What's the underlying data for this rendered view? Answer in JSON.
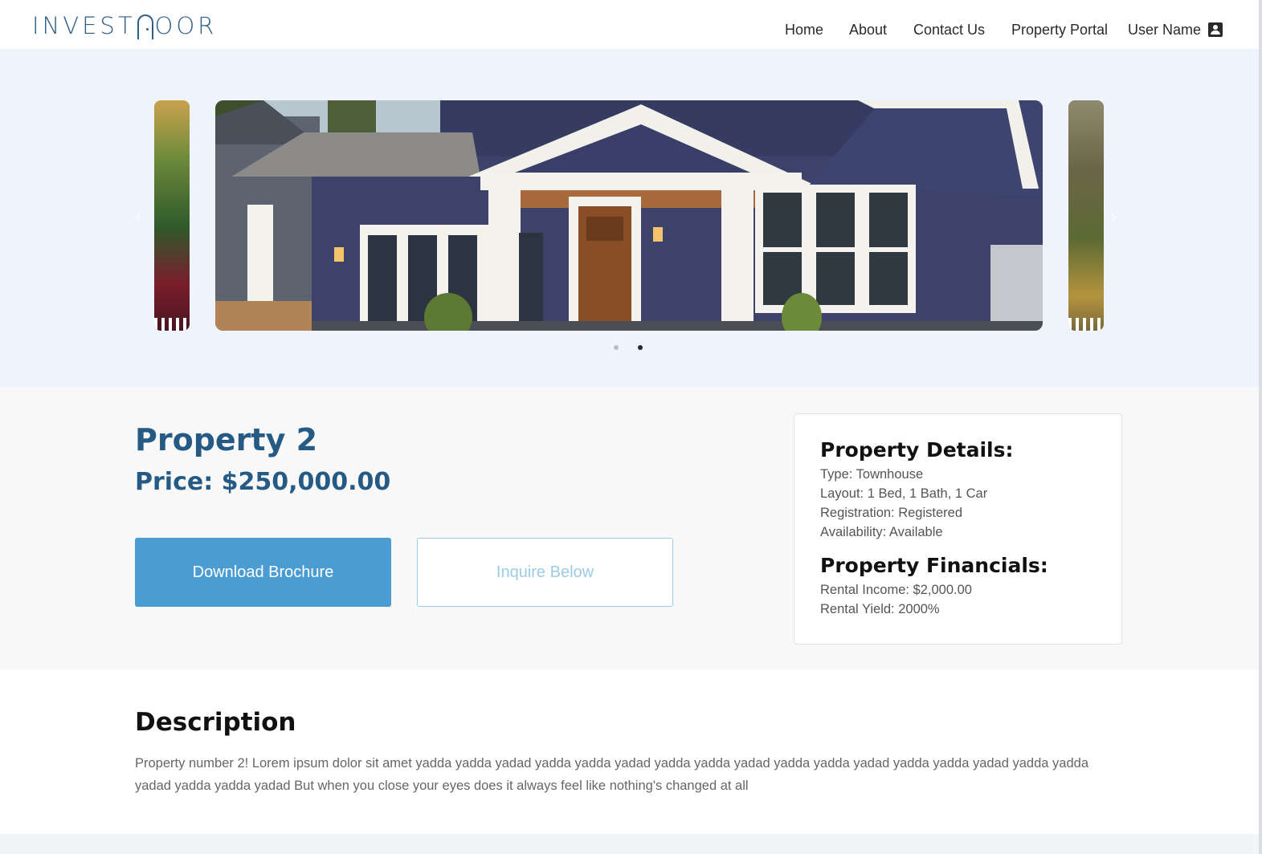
{
  "brand": {
    "logo_pre": "INVEST",
    "logo_post": "OOR"
  },
  "nav": {
    "items": [
      "Home",
      "About",
      "Contact Us",
      "Property Portal"
    ],
    "user_name": "User Name"
  },
  "carousel": {
    "prev_arrow": "‹",
    "next_arrow": "›",
    "dot_count": 2,
    "active_dot": 2
  },
  "property": {
    "title": "Property 2",
    "price": "Price: $250,000.00",
    "download_label": "Download Brochure",
    "inquire_label": "Inquire Below"
  },
  "details": {
    "heading": "Property Details:",
    "type": "Type: Townhouse",
    "layout": "Layout: 1 Bed, 1 Bath, 1 Car",
    "registration": "Registration: Registered",
    "availability": "Availability: Available"
  },
  "financials": {
    "heading": "Property Financials:",
    "rental_income": "Rental Income: $2,000.00",
    "rental_yield": "Rental Yield: 2000%"
  },
  "description": {
    "heading": "Description",
    "text": "Property number 2! Lorem ipsum dolor sit amet yadda yadda yadad yadda yadda yadad yadda yadda yadad yadda yadda yadad yadda yadda yadad yadda yadda yadad yadda yadda yadad But when you close your eyes does it always feel like nothing's changed at all"
  },
  "colors": {
    "brand_blue": "#255a85",
    "button_blue": "#4a9cd3",
    "carousel_bg": "#eff3fc"
  }
}
